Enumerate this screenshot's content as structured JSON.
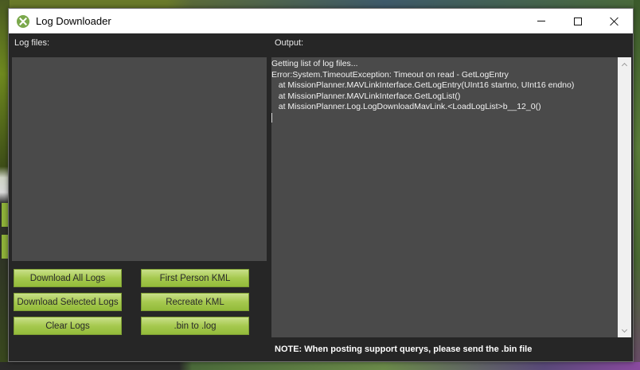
{
  "window": {
    "title": "Log Downloader"
  },
  "logfiles": {
    "label": "Log files:"
  },
  "output": {
    "label": "Output:",
    "lines": [
      "Getting list of log files...",
      "Error:System.TimeoutException: Timeout on read - GetLogEntry",
      "   at MissionPlanner.MAVLinkInterface.GetLogEntry(UInt16 startno, UInt16 endno)",
      "   at MissionPlanner.MAVLinkInterface.GetLogList()",
      "   at MissionPlanner.Log.LogDownloadMavLink.<LoadLogList>b__12_0()"
    ]
  },
  "buttons": {
    "download_all": "Download All Logs",
    "download_selected": "Download Selected Logs",
    "clear_logs": "Clear Logs",
    "first_person_kml": "First Person KML",
    "recreate_kml": "Recreate KML",
    "bin_to_log": ".bin to .log"
  },
  "note": "NOTE: When posting support querys, please send the .bin file",
  "colors": {
    "button_green": "#a6c94f",
    "panel_bg": "#4a4a4a",
    "window_bg": "#262626"
  },
  "icons": {
    "app": "mission-planner-icon",
    "minimize": "minimize-icon",
    "maximize": "maximize-icon",
    "close": "close-icon"
  }
}
